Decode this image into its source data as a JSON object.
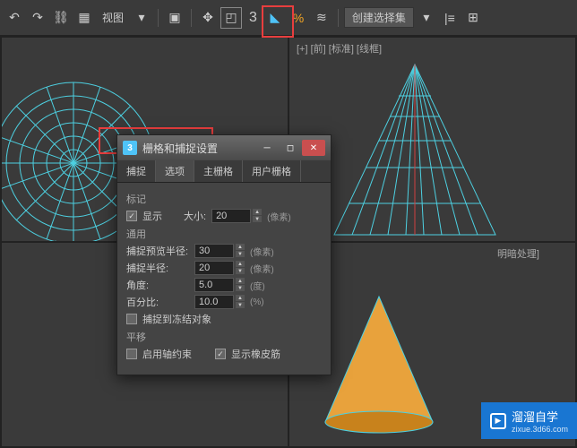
{
  "toolbar": {
    "view_label": "视图",
    "snap_num": "3",
    "create_select_set": "创建选择集"
  },
  "viewports": {
    "top_right_label": "[+] [前] [标准] [线框]",
    "bottom_right_label": "明暗处理]"
  },
  "dialog": {
    "title": "栅格和捕捉设置",
    "tabs": [
      "捕捉",
      "选项",
      "主栅格",
      "用户栅格"
    ],
    "sections": {
      "marker": "标记",
      "display": "显示",
      "size_label": "大小:",
      "size_value": "20",
      "size_unit": "(像素)",
      "general": "通用",
      "preview_radius_label": "捕捉预览半径:",
      "preview_radius_value": "30",
      "preview_radius_unit": "(像素)",
      "snap_radius_label": "捕捉半径:",
      "snap_radius_value": "20",
      "snap_radius_unit": "(像素)",
      "angle_label": "角度:",
      "angle_value": "5.0",
      "angle_unit": "(度)",
      "percent_label": "百分比:",
      "percent_value": "10.0",
      "percent_unit": "(%)",
      "snap_frozen": "捕捉到冻结对象",
      "translate": "平移",
      "axis_constraint": "启用轴约束",
      "rubber_band": "显示橡皮筋"
    }
  },
  "watermark": {
    "brand": "溜溜自学",
    "url": "zixue.3d66.com"
  }
}
